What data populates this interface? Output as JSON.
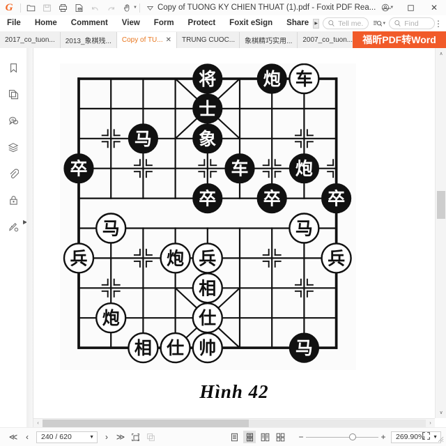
{
  "titlebar": {
    "logo": "G",
    "document_title": "Copy of TUONG KY CHIEN THUAT (1).pdf - Foxit PDF Rea...",
    "quick_access": [
      {
        "name": "open-file-icon",
        "label": "Open"
      },
      {
        "name": "save-icon",
        "label": "Save"
      },
      {
        "name": "print-icon",
        "label": "Print"
      },
      {
        "name": "email-icon",
        "label": "Email"
      },
      {
        "name": "undo-icon",
        "label": "Undo"
      },
      {
        "name": "redo-icon",
        "label": "Redo"
      },
      {
        "name": "hand-tool-icon",
        "label": "Hand Tool"
      }
    ],
    "window_controls": {
      "minimize": "—",
      "maximize": "☐",
      "close": "✕"
    }
  },
  "menubar": {
    "items": [
      {
        "label": "File"
      },
      {
        "label": "Home"
      },
      {
        "label": "Comment"
      },
      {
        "label": "View"
      },
      {
        "label": "Form"
      },
      {
        "label": "Protect"
      },
      {
        "label": "Foxit eSign"
      },
      {
        "label": "Share"
      }
    ],
    "tell_me_placeholder": "Tell me.",
    "find_placeholder": "Find",
    "more_label": "⋮"
  },
  "tabs": {
    "items": [
      {
        "label": "2017_co_tuon...",
        "active": false
      },
      {
        "label": "2013_象棋残...",
        "active": false
      },
      {
        "label": "Copy of TU...",
        "active": true
      },
      {
        "label": "TRUNG CUOC...",
        "active": false
      },
      {
        "label": "象棋精巧实用...",
        "active": false
      },
      {
        "label": "2007_co_tuon...",
        "active": false
      }
    ],
    "overflow_caret": "▼"
  },
  "ad_banner": {
    "text": "福昕PDF转Word",
    "color": "#f15a29"
  },
  "left_rail": {
    "items": [
      {
        "name": "bookmark-icon",
        "label": "Bookmarks"
      },
      {
        "name": "page-thumbnails-icon",
        "label": "Page Thumbnails"
      },
      {
        "name": "comments-icon",
        "label": "Comments"
      },
      {
        "name": "layers-icon",
        "label": "Layers"
      },
      {
        "name": "attachments-icon",
        "label": "Attachments"
      },
      {
        "name": "security-icon",
        "label": "Security"
      },
      {
        "name": "signatures-icon",
        "label": "Digital Signatures"
      }
    ],
    "expand_arrow": "▶"
  },
  "document": {
    "caption": "Hình 42",
    "board": {
      "title": "Xiangqi diagram Hinh 42",
      "columns": 9,
      "rows": 10,
      "pieces": [
        {
          "char": "将",
          "col": 4,
          "row": 0,
          "side": "black"
        },
        {
          "char": "炮",
          "col": 6,
          "row": 0,
          "side": "black"
        },
        {
          "char": "车",
          "col": 7,
          "row": 0,
          "side": "white"
        },
        {
          "char": "士",
          "col": 4,
          "row": 1,
          "side": "black"
        },
        {
          "char": "马",
          "col": 2,
          "row": 2,
          "side": "black"
        },
        {
          "char": "象",
          "col": 4,
          "row": 2,
          "side": "black"
        },
        {
          "char": "卒",
          "col": 0,
          "row": 3,
          "side": "black"
        },
        {
          "char": "车",
          "col": 5,
          "row": 3,
          "side": "black"
        },
        {
          "char": "炮",
          "col": 7,
          "row": 3,
          "side": "black"
        },
        {
          "char": "卒",
          "col": 4,
          "row": 4,
          "side": "black"
        },
        {
          "char": "卒",
          "col": 6,
          "row": 4,
          "side": "black"
        },
        {
          "char": "卒",
          "col": 8,
          "row": 4,
          "side": "black"
        },
        {
          "char": "马",
          "col": 1,
          "row": 5,
          "side": "white"
        },
        {
          "char": "马",
          "col": 7,
          "row": 5,
          "side": "white"
        },
        {
          "char": "兵",
          "col": 0,
          "row": 6,
          "side": "white"
        },
        {
          "char": "炮",
          "col": 3,
          "row": 6,
          "side": "white"
        },
        {
          "char": "兵",
          "col": 4,
          "row": 6,
          "side": "white"
        },
        {
          "char": "兵",
          "col": 8,
          "row": 6,
          "side": "white"
        },
        {
          "char": "相",
          "col": 4,
          "row": 7,
          "side": "white"
        },
        {
          "char": "炮",
          "col": 1,
          "row": 8,
          "side": "white"
        },
        {
          "char": "仕",
          "col": 4,
          "row": 8,
          "side": "white"
        },
        {
          "char": "相",
          "col": 2,
          "row": 9,
          "side": "white"
        },
        {
          "char": "仕",
          "col": 3,
          "row": 9,
          "side": "white"
        },
        {
          "char": "帅",
          "col": 4,
          "row": 9,
          "side": "white"
        },
        {
          "char": "马",
          "col": 7,
          "row": 9,
          "side": "black"
        }
      ]
    }
  },
  "statusbar": {
    "first_page": "≪",
    "prev_page": "‹",
    "page_value": "240 / 620",
    "page_caret": "▼",
    "next_page": "›",
    "last_page": "≫",
    "tools": [
      {
        "name": "snapshot-icon",
        "label": "Snapshot"
      },
      {
        "name": "copy-icon",
        "label": "Copy"
      }
    ],
    "view_modes": [
      {
        "name": "single-page-mode",
        "selected": false
      },
      {
        "name": "continuous-page-mode",
        "selected": true
      },
      {
        "name": "facing-page-mode",
        "selected": false
      },
      {
        "name": "facing-continuous-mode",
        "selected": false
      }
    ],
    "zoom_out": "−",
    "zoom_in": "+",
    "zoom_value": "269.90%",
    "zoom_caret": "▼",
    "fit_label": "Fit Page"
  },
  "scrollbars": {
    "vertical_up": "∧",
    "vertical_down": "∨",
    "horizontal_left": "‹",
    "horizontal_right": "›"
  }
}
